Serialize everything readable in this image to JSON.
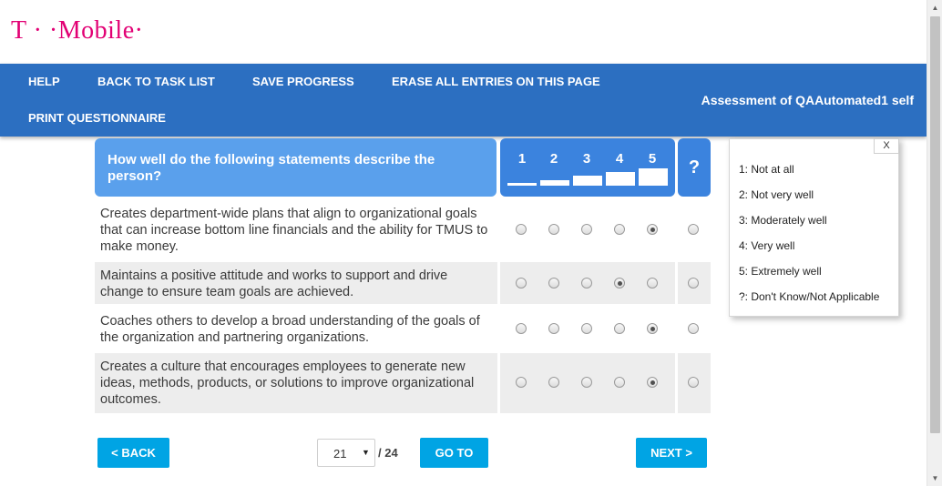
{
  "brand": {
    "logo_text": "T · ·Mobile·",
    "color": "#e20074"
  },
  "nav": {
    "help": "HELP",
    "back_to_task_list": "BACK TO TASK LIST",
    "save_progress": "SAVE PROGRESS",
    "erase_all": "ERASE ALL ENTRIES ON THIS PAGE",
    "print": "PRINT QUESTIONNAIRE",
    "title": "Assessment of QAAutomated1 self",
    "bg_color": "#2c6fc1"
  },
  "question": {
    "header": "How well do the following statements describe the person?",
    "scale_labels": [
      "1",
      "2",
      "3",
      "4",
      "5"
    ],
    "unknown_label": "?",
    "rows": [
      {
        "text": "Creates department-wide plans that align to organizational goals that can increase bottom line financials and the ability for TMUS to make money.",
        "selected": "5"
      },
      {
        "text": "Maintains a positive attitude and works to support and drive change to ensure team goals are achieved.",
        "selected": "4"
      },
      {
        "text": "Coaches others to develop a broad understanding of the goals of the organization and partnering organizations.",
        "selected": "5"
      },
      {
        "text": "Creates a culture that encourages employees to generate new ideas, methods, products, or solutions to improve organizational outcomes.",
        "selected": "5"
      }
    ]
  },
  "legend": {
    "close_label": "X",
    "items": [
      "1: Not at all",
      "2: Not very well",
      "3: Moderately well",
      "4: Very well",
      "5: Extremely well",
      "?: Don't Know/Not Applicable"
    ]
  },
  "pager": {
    "back_label": "< BACK",
    "current_page": "21",
    "total": "/ 24",
    "goto_label": "GO TO",
    "next_label": "NEXT >",
    "button_color": "#00a4e4"
  }
}
